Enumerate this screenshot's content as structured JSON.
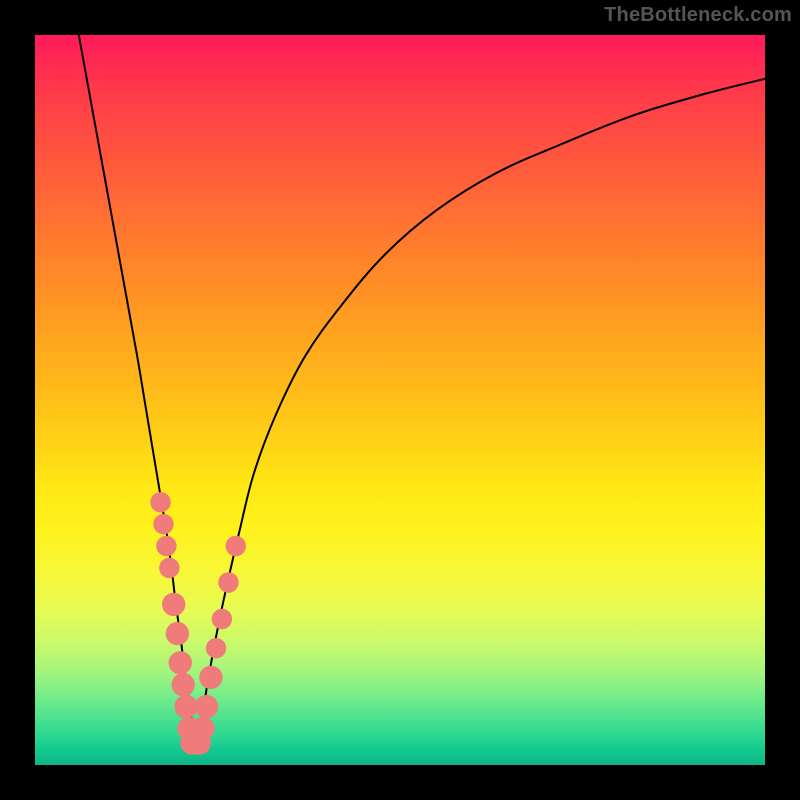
{
  "watermark": "TheBottleneck.com",
  "chart_data": {
    "type": "line",
    "title": "",
    "xlabel": "",
    "ylabel": "",
    "xlim": [
      0,
      100
    ],
    "ylim": [
      0,
      100
    ],
    "grid": false,
    "notes": "Background is a vertical gradient from red (top) through orange/yellow to green (bottom). Two black curves form a V with minimum near x≈22. Pink beads sit along both curve branches in the yellow/green band near the trough.",
    "series": [
      {
        "name": "left-branch",
        "x": [
          6,
          8,
          10,
          12,
          14,
          15,
          16,
          17,
          18,
          18.7,
          19.3,
          20,
          20.6,
          21.2,
          21.8,
          22
        ],
        "y": [
          100,
          89,
          78,
          67,
          56,
          50,
          44,
          38,
          32,
          27,
          22,
          17,
          12,
          8,
          4,
          2
        ]
      },
      {
        "name": "right-branch",
        "x": [
          22,
          22.8,
          23.6,
          24.5,
          25.5,
          26.6,
          28,
          30,
          33,
          37,
          42,
          48,
          55,
          63,
          72,
          82,
          92,
          100
        ],
        "y": [
          2,
          6,
          11,
          16,
          21,
          26,
          32,
          40,
          48,
          56,
          63,
          70,
          76,
          81,
          85,
          89,
          92,
          94
        ]
      }
    ],
    "beads": [
      {
        "branch": "left",
        "x": 17.2,
        "y": 36,
        "r": 1.4
      },
      {
        "branch": "left",
        "x": 17.6,
        "y": 33,
        "r": 1.4
      },
      {
        "branch": "left",
        "x": 18.0,
        "y": 30,
        "r": 1.4
      },
      {
        "branch": "left",
        "x": 18.4,
        "y": 27,
        "r": 1.4
      },
      {
        "branch": "left",
        "x": 19.0,
        "y": 22,
        "r": 1.6
      },
      {
        "branch": "left",
        "x": 19.5,
        "y": 18,
        "r": 1.6
      },
      {
        "branch": "left",
        "x": 19.9,
        "y": 14,
        "r": 1.6
      },
      {
        "branch": "left",
        "x": 20.3,
        "y": 11,
        "r": 1.6
      },
      {
        "branch": "left",
        "x": 20.7,
        "y": 8,
        "r": 1.6
      },
      {
        "branch": "left",
        "x": 21.1,
        "y": 5,
        "r": 1.6
      },
      {
        "branch": "left",
        "x": 21.5,
        "y": 3,
        "r": 1.6
      },
      {
        "branch": "right",
        "x": 22.5,
        "y": 3,
        "r": 1.6
      },
      {
        "branch": "right",
        "x": 23.0,
        "y": 5,
        "r": 1.6
      },
      {
        "branch": "right",
        "x": 23.5,
        "y": 8,
        "r": 1.6
      },
      {
        "branch": "right",
        "x": 24.1,
        "y": 12,
        "r": 1.6
      },
      {
        "branch": "right",
        "x": 24.8,
        "y": 16,
        "r": 1.4
      },
      {
        "branch": "right",
        "x": 25.6,
        "y": 20,
        "r": 1.4
      },
      {
        "branch": "right",
        "x": 26.5,
        "y": 25,
        "r": 1.4
      },
      {
        "branch": "right",
        "x": 27.5,
        "y": 30,
        "r": 1.4
      }
    ]
  }
}
